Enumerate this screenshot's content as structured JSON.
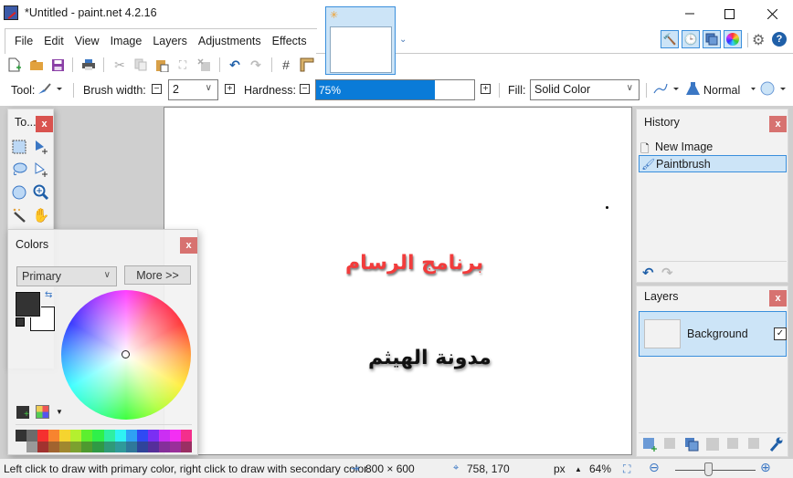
{
  "window": {
    "title": "*Untitled - paint.net 4.2.16",
    "minimize_icon": "minimize-icon",
    "maximize_icon": "maximize-icon",
    "close_icon": "close-icon"
  },
  "menu": {
    "items": [
      "File",
      "Edit",
      "View",
      "Image",
      "Layers",
      "Adjustments",
      "Effects"
    ]
  },
  "pane_toggles": [
    "tools-icon",
    "history-icon",
    "layers-icon",
    "colors-icon"
  ],
  "settings_icon": "gear-icon",
  "help_icon": "help-icon",
  "toolbar": {
    "icons": [
      "new-image-icon",
      "open-icon",
      "save-icon",
      "print-icon",
      "cut-icon",
      "copy-icon",
      "paste-icon",
      "crop-icon",
      "deselect-icon",
      "undo-icon",
      "redo-icon",
      "grid-icon",
      "ruler-icon"
    ]
  },
  "options": {
    "tool_label": "Tool:",
    "brush_width_label": "Brush width:",
    "brush_width_value": "2",
    "hardness_label": "Hardness:",
    "hardness_value": "75%",
    "hardness_percent": 75,
    "fill_label": "Fill:",
    "fill_value": "Solid Color",
    "blend_mode": "Normal"
  },
  "canvas": {
    "text_red": "برنامج الرسام",
    "text_black": "مدونة الهيثم"
  },
  "tools_panel": {
    "title": "To...",
    "close": "x",
    "tools": [
      "rectangle-select-icon",
      "move-selection-icon",
      "lasso-select-icon",
      "move-selected-icon",
      "ellipse-select-icon",
      "zoom-icon",
      "magic-wand-icon",
      "pan-icon"
    ]
  },
  "colors_panel": {
    "title": "Colors",
    "close": "x",
    "mode": "Primary",
    "more_button": "More >>",
    "primary_color": "#333333",
    "secondary_color": "#ffffff",
    "palette_top": [
      "#333333",
      "#6b6b6b",
      "#f5302f",
      "#f7842f",
      "#f5d42f",
      "#b4f02f",
      "#5cef2f",
      "#2ff04a",
      "#2fefa2",
      "#2ff3f3",
      "#2fa2f3",
      "#2f4af3",
      "#7a2ff3",
      "#cb2ff3",
      "#f32ff3",
      "#f32f8c"
    ],
    "palette_bottom": [
      "#ffffff",
      "#999999",
      "#a1322f",
      "#a1632f",
      "#a1882f",
      "#7ca12f",
      "#4e9a2f",
      "#2f9a44",
      "#2f9a78",
      "#2f9a9a",
      "#2f789a",
      "#2f449a",
      "#552f9a",
      "#852f9a",
      "#9a2f9a",
      "#9a2f63"
    ]
  },
  "history_panel": {
    "title": "History",
    "close": "x",
    "items": [
      "New Image",
      "Paintbrush"
    ],
    "selected_index": 1
  },
  "layers_panel": {
    "title": "Layers",
    "close": "x",
    "layers": [
      {
        "name": "Background",
        "visible": true
      }
    ]
  },
  "status_bar": {
    "hint": "Left click to draw with primary color, right click to draw with secondary color.",
    "image_size": "800 × 600",
    "cursor_pos": "758, 170",
    "units": "px",
    "zoom": "64%"
  }
}
